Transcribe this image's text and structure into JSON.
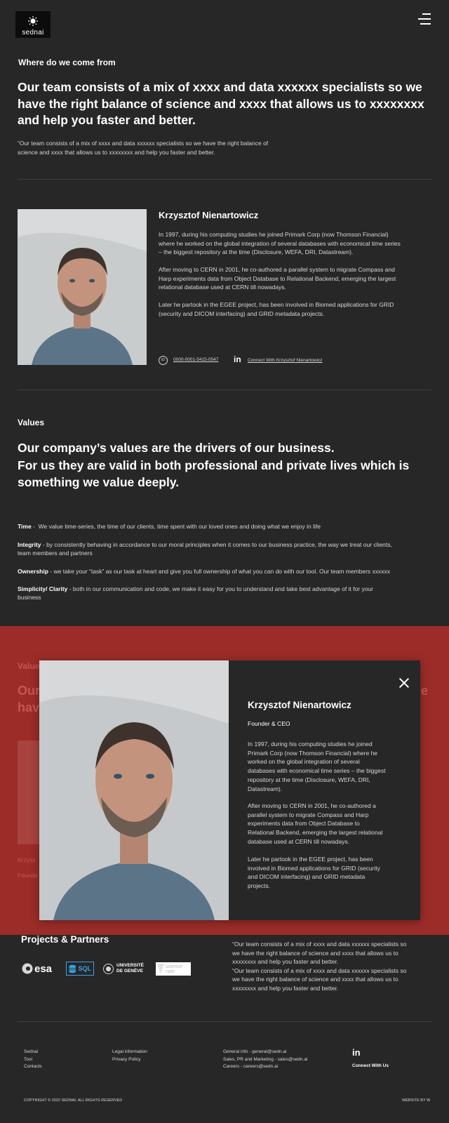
{
  "header": {
    "logo_text": "sednai",
    "menu_icon": "hamburger-menu-icon"
  },
  "intro": {
    "eyebrow": "Where do we come from",
    "headline_lines": [
      "Our team consists of a mix of xxxx and data xxxxxx specialists so we",
      "have the right balance of science and xxxx that allows us to xxxxxxxx",
      "and help you faster and better."
    ],
    "quote_lines": [
      "“Our team consists of a mix of xxxx and data xxxxxx specialists so we have the right balance of",
      "science and xxxx that allows us to xxxxxxxx and help you faster and better."
    ]
  },
  "bio": {
    "name": "Krzysztof Nienartowicz",
    "p1": [
      "In 1997, during his computing studies he joined Primark Corp (now Thomson Financial)",
      "where he worked on the global integration of several databases with economical time series",
      "– the biggest repository at the time (Disclosure, WEFA, DRI, Datastream)."
    ],
    "p2": [
      "After moving to CERN in 2001, he co-authored a parallel system to migrate Compass and",
      "Harp experiments data from Object Database to Relational Backend, emerging the largest",
      "relational database used at CERN till nowadays."
    ],
    "p3": [
      "Later he partook in the EGEE project, has been involved in Biomed applications for GRID",
      "(security and DICOM interfacing) and GRID metadata projects."
    ],
    "orcid_badge": "iD",
    "orcid": "0000-0001-5415-0547",
    "linkedin_icon": "in",
    "linkedin_label": "Connect With Krzysztof Nienartowicz"
  },
  "values": {
    "eyebrow": "Values",
    "headline_lines": [
      "Our company’s values are the drivers of our business.",
      "For us they are valid in both professional and private lives which is",
      "something we value deeply."
    ],
    "items": [
      {
        "term": "Time",
        "sep": " -  ",
        "lines": [
          "We value time-series, the time of our clients, time spent with our loved ones and doing what we enjoy in life"
        ]
      },
      {
        "term": "Integrity",
        "sep": " - ",
        "lines": [
          "by consistently behaving in accordance to our moral principles when it comes to  our business practice, the way we treat our clients,",
          "team members and partners"
        ]
      },
      {
        "term": "Ownership",
        "sep": " - ",
        "lines": [
          "we take your “task” as our task at heart and give you full ownership of what you can do with our tool. Our team members xxxxxx"
        ]
      },
      {
        "term": "Simplicity/ Clarity",
        "sep": " - ",
        "lines": [
          "both in our communication and code, we make it easy for you to understand and take best advantage of it for your",
          "business"
        ]
      }
    ]
  },
  "background_fragments": {
    "eyebrow": "Value",
    "line1_left": "Our",
    "line1_right": "e",
    "line2_left": "hav",
    "name_left": "Krzysz",
    "role_left": "Founde"
  },
  "modal": {
    "name": "Krzysztof Nienartowicz",
    "role": "Founder & CEO",
    "p1": [
      "In 1997, during his computing studies he joined",
      "Primark Corp (now Thomson Financial) where he",
      "worked on the global integration of several",
      "databases with economical time series – the biggest",
      "repository at the time (Disclosure, WEFA, DRI,",
      "Datastream)."
    ],
    "p2": [
      "After moving to CERN in 2001, he co-authored a",
      "parallel system to migrate Compass and Harp",
      "experiments data from Object Database to",
      "Relational Backend, emerging the largest relational",
      "database used at CERN till nowadays."
    ],
    "p3": [
      "Later he partook in the EGEE project, has been",
      "involved in Biomed applications for GRID (security",
      "and DICOM interfacing) and GRID metadata",
      "projects."
    ],
    "close_icon": "close-icon"
  },
  "partners": {
    "title": "Projects & Partners",
    "logos": [
      "esa",
      "SQL",
      "UNIVERSITÉ",
      "DE GENÈVE",
      "science",
      "now"
    ],
    "quote_lines": [
      "“Our team consists of a mix of xxxx and data xxxxxx specialists so",
      "we have the right balance of science and xxxx that allows us to",
      "xxxxxxxx and help you faster and better.",
      "“Our team consists of a mix of xxxx and data xxxxxx specialists so",
      "we have the right balance of science and xxxx that allows us to",
      "xxxxxxxx and help you faster and better."
    ]
  },
  "footer": {
    "col1": [
      "Sednai",
      "Tool",
      "Contacts"
    ],
    "col2": [
      "Legal information",
      "Privacy Policy"
    ],
    "col3": [
      "General info - general@sedn.ai",
      "Sales, PR and Marketing - sales@sedn.ai",
      "Careers - careers@sedn.ai"
    ],
    "linkedin_icon": "in",
    "connect_label": "Connect With Us",
    "copyright": "COPYRIGHT © 2022 SEDNAI. ALL RIGHTS RESERVED",
    "credit": "WEBSITE BY W"
  },
  "colors": {
    "background": "#272727",
    "accent_red": "#9b2c28",
    "text": "#ffffff",
    "muted_text": "#d7d7d7"
  }
}
